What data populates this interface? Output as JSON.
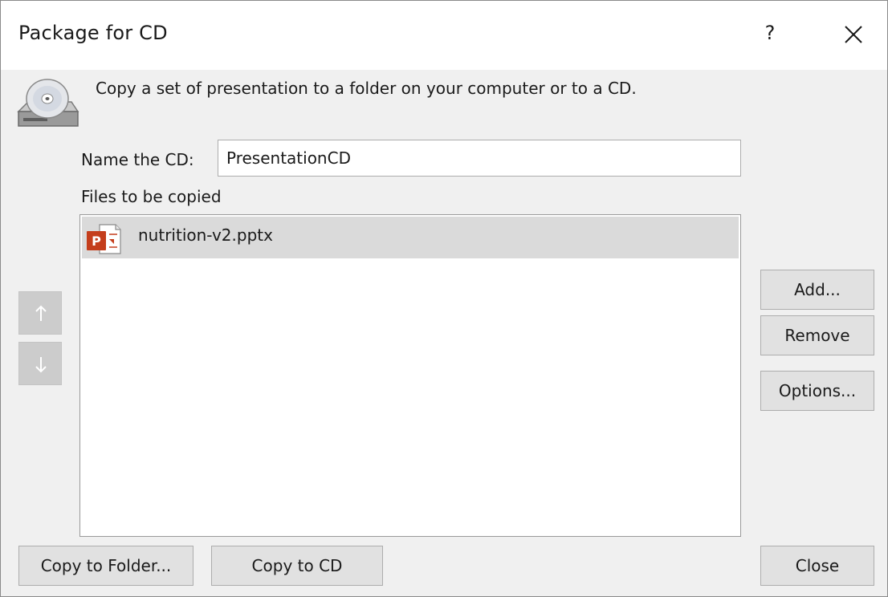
{
  "dialog": {
    "title": "Package for CD",
    "help_label": "?",
    "intro_text": "Copy a set of presentation to a folder on your computer or to a CD.",
    "name_label": "Name the CD:",
    "name_value": "PresentationCD",
    "files_label": "Files to be copied",
    "files": [
      {
        "name": "nutrition-v2.pptx",
        "icon": "powerpoint-file-icon",
        "selected": true
      }
    ],
    "buttons": {
      "add": "Add...",
      "remove": "Remove",
      "options": "Options...",
      "copy_to_folder": "Copy to Folder...",
      "copy_to_cd": "Copy to CD",
      "close": "Close"
    },
    "icons": {
      "cd": "cd-drive-icon",
      "close": "close-icon",
      "move_up": "arrow-up-icon",
      "move_down": "arrow-down-icon"
    },
    "colors": {
      "ppt_brand": "#c43e1c",
      "selection": "#dadada",
      "button_face": "#e1e1e1"
    }
  }
}
